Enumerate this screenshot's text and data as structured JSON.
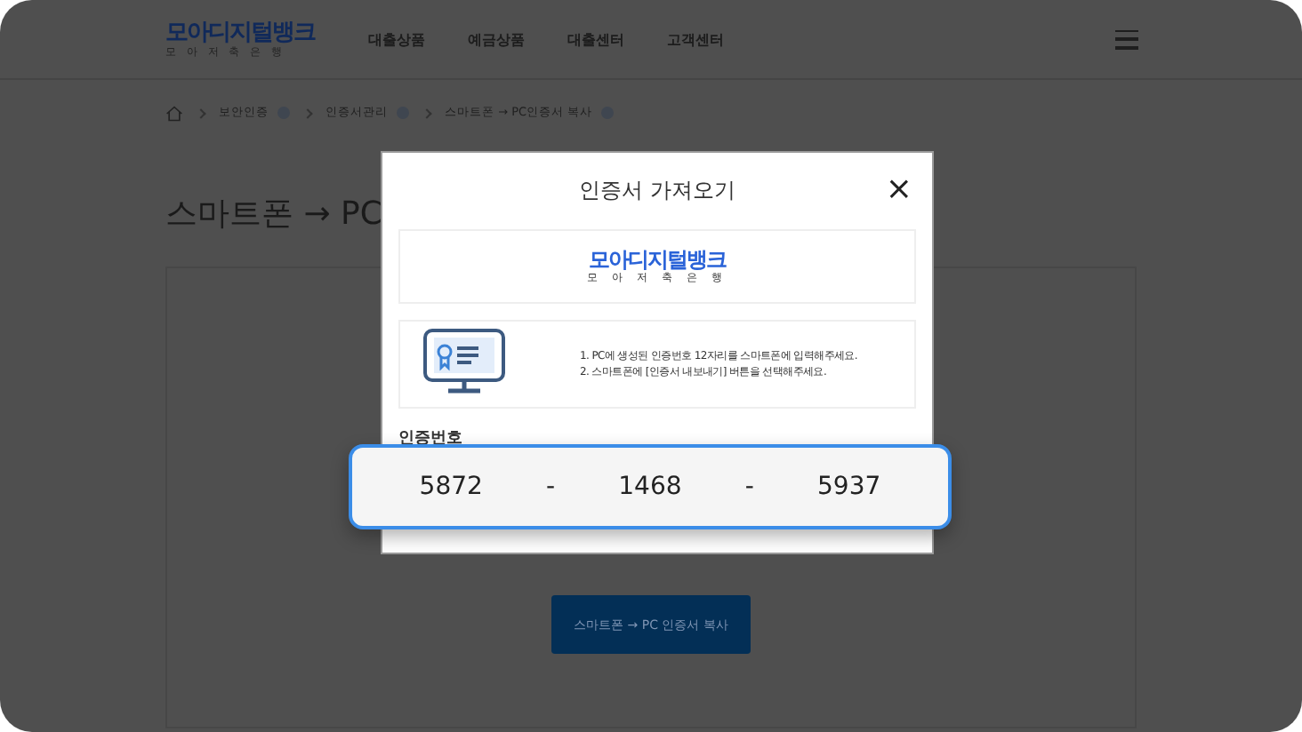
{
  "header": {
    "logo": {
      "name": "모아디지털뱅크",
      "subtitle": "모 아 저 축 은 행"
    },
    "nav": [
      "대출상품",
      "예금상품",
      "대출센터",
      "고객센터"
    ]
  },
  "breadcrumb": [
    "보안인증",
    "인증서관리",
    "스마트폰 → PC인증서 복사"
  ],
  "page_title": "스마트폰 → PC",
  "copy_button": "스마트폰 → PC 인증서 복사",
  "modal": {
    "title": "인증서 가져오기",
    "close": "×",
    "logo": {
      "name": "모아디지털뱅크",
      "subtitle": "모 아 저 축 은 행"
    },
    "instructions": [
      "1. PC에 생성된 인증번호 12자리를 스마트폰에 입력해주세요.",
      "2. 스마트폰에 [인증서 내보내기] 버튼을 선택해주세요."
    ],
    "code_label": "인증번호",
    "code": [
      "5872",
      "1468",
      "5937"
    ],
    "separator": "-"
  }
}
